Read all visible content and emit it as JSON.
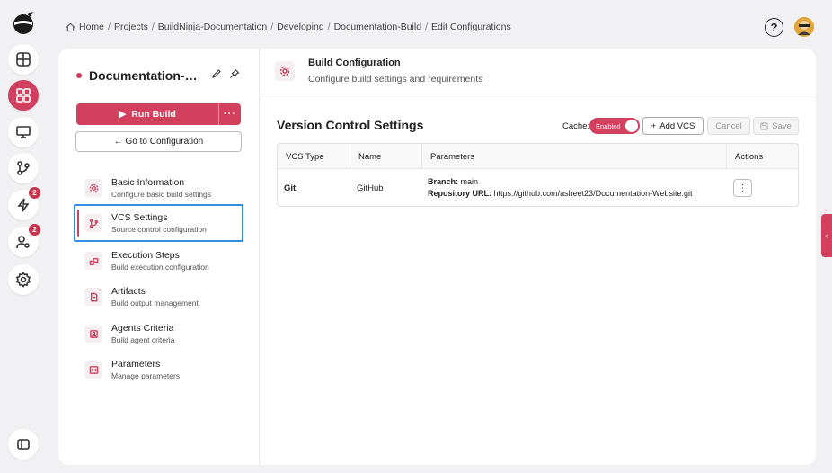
{
  "breadcrumb": {
    "items": [
      "Home",
      "Projects",
      "BuildNinja-Documentation",
      "Developing",
      "Documentation-Build",
      "Edit Configurations"
    ],
    "separator": "/"
  },
  "rail": {
    "items": [
      {
        "icon": "dashboard-grid-icon"
      },
      {
        "icon": "apps-icon",
        "active": true
      },
      {
        "icon": "monitor-icon"
      },
      {
        "icon": "branch-icon"
      },
      {
        "icon": "lightning-icon",
        "badge": "2"
      },
      {
        "icon": "users-gear-icon",
        "badge": "2"
      },
      {
        "icon": "settings-icon"
      }
    ]
  },
  "top": {
    "help_label": "?"
  },
  "build": {
    "name": "Documentation-Bu...",
    "run_label": "Run Build",
    "run_more_label": "···",
    "goto_label": "← Go to Configuration"
  },
  "nav": [
    {
      "title": "Basic Information",
      "subtitle": "Configure basic build settings",
      "icon": "gear-icon"
    },
    {
      "title": "VCS Settings",
      "subtitle": "Source control configuration",
      "icon": "branch-icon",
      "active": true
    },
    {
      "title": "Execution Steps",
      "subtitle": "Build execution configuration",
      "icon": "steps-icon"
    },
    {
      "title": "Artifacts",
      "subtitle": "Build output management",
      "icon": "file-icon"
    },
    {
      "title": "Agents Criteria",
      "subtitle": "Build agent criteria",
      "icon": "agent-icon"
    },
    {
      "title": "Parameters",
      "subtitle": "Manage parameters",
      "icon": "code-icon"
    }
  ],
  "config": {
    "title": "Build Configuration",
    "subtitle": "Configure build settings and requirements"
  },
  "vcs": {
    "title": "Version Control Settings",
    "cache_label": "Cache:",
    "cache_state": "Enabled",
    "add_label": "Add VCS",
    "add_prefix": "+",
    "cancel_label": "Cancel",
    "save_label": "Save",
    "columns": [
      "VCS Type",
      "Name",
      "Parameters",
      "Actions"
    ],
    "rows": [
      {
        "type": "Git",
        "name": "GitHub",
        "branch_label": "Branch:",
        "branch": "main",
        "repo_label": "Repository URL:",
        "repo": "https://github.com/asheet23/Documentation-Website.git",
        "actions": "⋮"
      }
    ]
  },
  "side_tab": {
    "label": "‹"
  },
  "colors": {
    "accent": "#d2405e",
    "focus": "#2f8ee3"
  }
}
